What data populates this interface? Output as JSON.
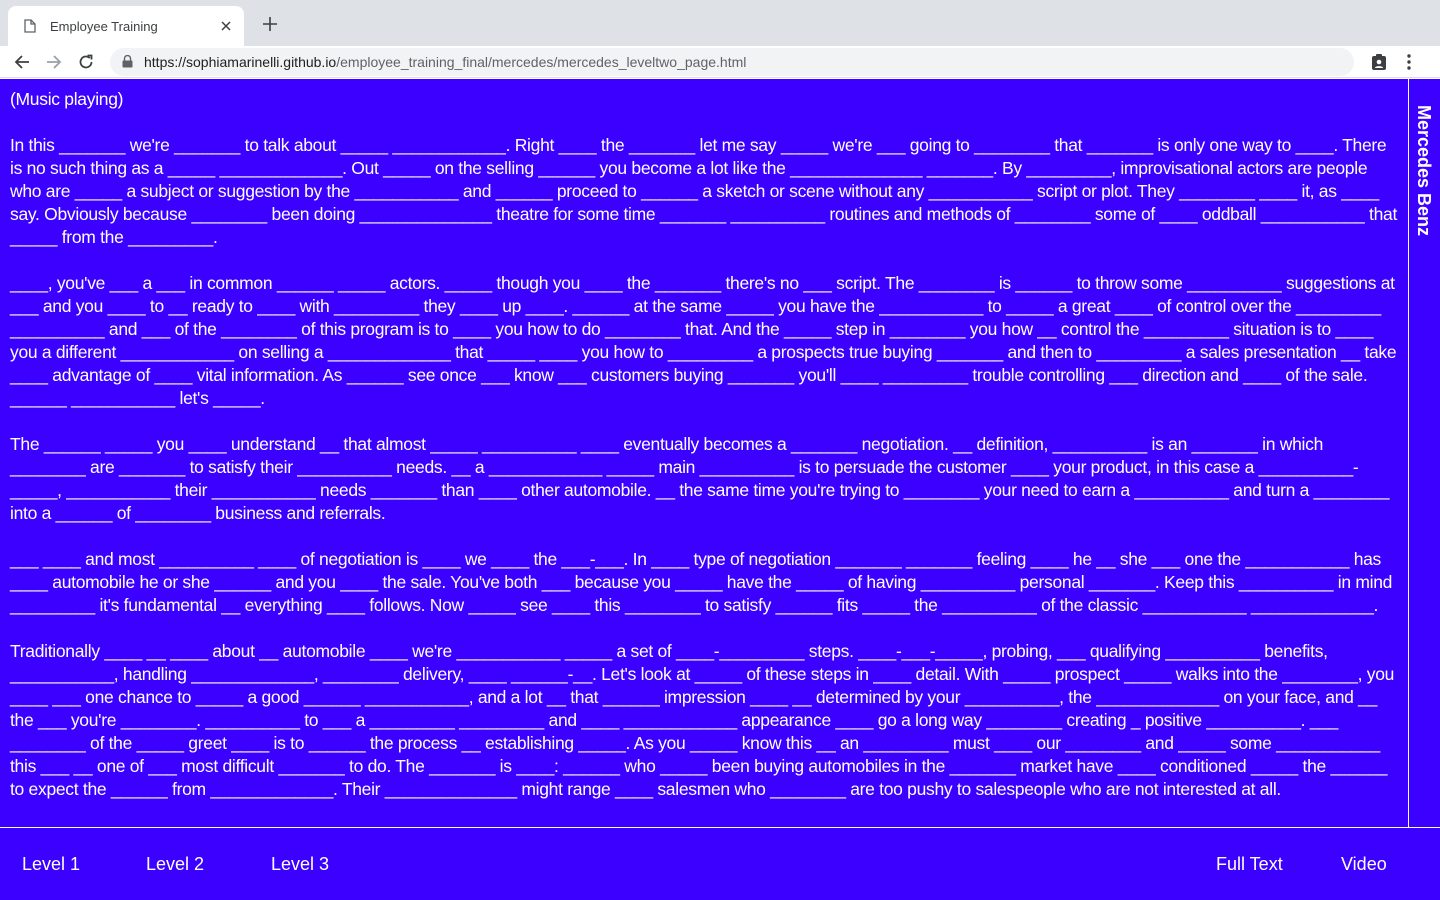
{
  "browser": {
    "tab_title": "Employee Training",
    "url_host": "https://sophiamarinelli.github.io",
    "url_path": "/employee_training_final/mercedes/mercedes_leveltwo_page.html"
  },
  "page": {
    "side_label": "Mercedes Benz",
    "paragraphs": [
      "(Music playing)",
      "In this _______ we're _______ to talk about _____ ____________. Right ____ the _______ let me say _____ we're ___ going to ________ that _______ is only one way to ____. There is no such thing as a _____ _____________. Out _____ on the selling ______ you become a lot like the ______________ _______. By _________, improvisational actors are people who are _____ a subject or suggestion by the ___________ and ______ proceed to ______ a sketch or scene without any ___________ script or plot. They ________ ____ it, as ____ say. Obviously because ________ been doing ______________ theatre for some time _______ __________ routines and methods of ________ some of ____ oddball ___________ that _____ from the _________.",
      "____, you've ___ a ___ in common ______ _____ actors. _____ though you ____ the _______ there's no ___ script. The ________ is ______ to throw some __________ suggestions at ___ and you ____ to __ ready to ____ with _________ they ____ up ____. ______ at the same _____ you have the ___________ to _____ a great ____ of control over the _________ __________ and ___ of the ________ of this program is to ____ you how to do ________ that. And the _____ step in ________ you how __ control the _________ situation is to ____ you a different ____________ on selling a _____________ that _____ ____ you how to _________ a prospects true buying _______ and then to _________ a sales presentation __ take ____ advantage of ____ vital information. As ______ see once ___ know ___ customers buying _______ you'll ____ _________ trouble controlling ___ direction and ____ of the sale. ______ ___________ let's _____.",
      "The ______ _____ you ____ understand __ that almost _____ __________ ____ eventually becomes a _______ negotiation. __ definition, __________ is an _______ in which ________ are _______ to satisfy their __________ needs. __ a ____________ _____ main __________ is to persuade the customer ____ your product, in this case a __________-_____, ___________ their ___________ needs _______ than ____ other automobile. __ the same time you're trying to ________ your need to earn a __________ and turn a ________ into a ______ of ________ business and referrals.",
      "___ ____ and most __________ ____ of negotiation is ____ we ____ the ___-___. In ____ type of negotiation _______ _______ feeling ____ he __ she ___ one the ___________ has ____ automobile he or she ______ and you ____ the sale. You've both ___ because you _____ have the _____ of having __________ personal _______. Keep this __________ in mind _________ it's fundamental __ everything ____ follows. Now _____ see ____ this ________ to satisfy ______ fits _____ the __________ of the classic ___________ _____________.",
      "Traditionally ____ __ ____ about __ automobile ____ we're ___________ _____ a set of ____-_________ steps. ____-___-_____, probing, ___ qualifying __________ benefits, ___________, handling _____________, ________ delivery, ____ ______-__. Let's look at _____ of these steps in ____ detail. With _____ prospect _____ walks into the ________, you ____ ___ one chance to _____ a good ______ ___________, and a lot __ that ______ impression ____ __ determined by your __________, the _____________ on your face, and __ the ___ you're ________. __________ to ___ a _________ _________ and ____ ____________ appearance ____ go a long way ________ creating _ positive __________. ___ ________ of the _____ greet ____ is to ______ the process __ establishing _____. As you _____ know this __ an _________ must ____ our ________ and _____ some ___________ this ___ __ one of ___ most difficult _______ to do. The _______ is ____: ______ who _____ been buying automobiles in the _______ market have ____ conditioned _____ the ______ to expect the ______ from _____________. Their ______________ might range ____ salesmen who ________ are too pushy to salespeople who are not interested at all."
    ],
    "nav": {
      "level1": "Level 1",
      "level2": "Level 2",
      "level3": "Level 3",
      "full_text": "Full Text",
      "video": "Video"
    }
  },
  "colors": {
    "page_bg": "#3b00ff",
    "text": "#ffffff"
  }
}
